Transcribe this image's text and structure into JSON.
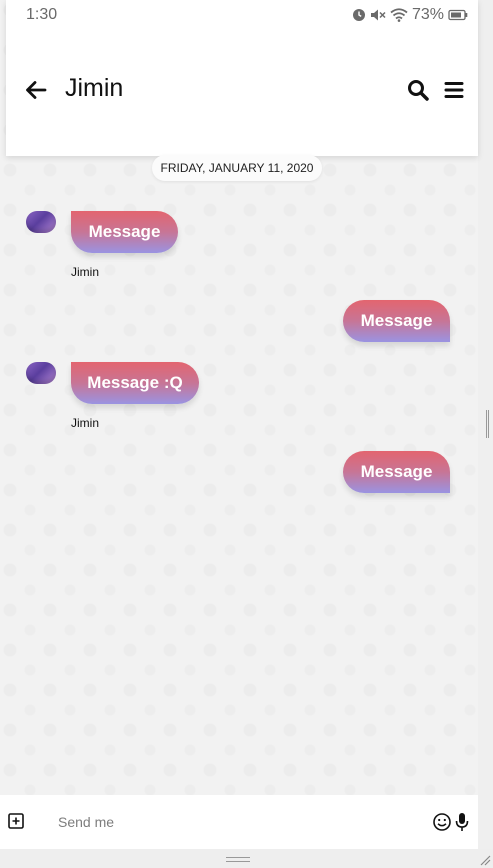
{
  "status_bar": {
    "time": "1:30",
    "battery": "73%",
    "icons": [
      "alarm-icon",
      "mute-icon",
      "wifi-icon",
      "battery-icon"
    ]
  },
  "header": {
    "title": "Jimin",
    "back_icon": "arrow-left-icon",
    "search_icon": "search-icon",
    "menu_icon": "hamburger-menu-icon"
  },
  "conversation": {
    "date_label": "FRIDAY, JANUARY 11, 2020",
    "messages": [
      {
        "direction": "incoming",
        "text": "Message",
        "sender": "Jimin"
      },
      {
        "direction": "outgoing",
        "text": "Message"
      },
      {
        "direction": "incoming",
        "text": "Message :Q",
        "sender": "Jimin"
      },
      {
        "direction": "outgoing",
        "text": "Message"
      }
    ]
  },
  "composer": {
    "placeholder": "Send me",
    "value": "",
    "add_icon": "plus-square-icon",
    "emoji_icon": "smiley-icon",
    "mic_icon": "microphone-icon"
  },
  "colors": {
    "bubble_gradient_top": "#e3656f",
    "bubble_gradient_bottom": "#9a93e2",
    "header_background": "#ffffff",
    "chat_background": "#f2f2f2"
  }
}
